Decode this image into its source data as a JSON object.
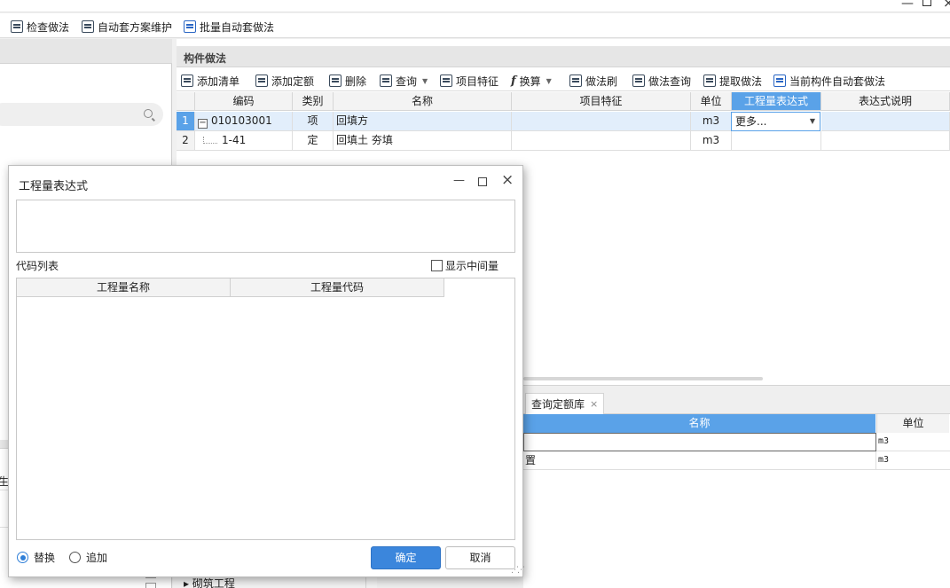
{
  "top_toolbar": {
    "check_method": "检查做法",
    "auto_scheme": "自动套方案维护",
    "batch_auto": "批量自动套做法"
  },
  "main_panel": {
    "title": "构件做法",
    "toolbar": {
      "add_list": "添加清单",
      "add_quota": "添加定额",
      "delete": "删除",
      "query": "查询",
      "feature": "项目特征",
      "convert": "换算",
      "method_brush": "做法刷",
      "method_query": "做法查询",
      "extract": "提取做法",
      "current_auto": "当前构件自动套做法"
    },
    "grid": {
      "columns": [
        "编码",
        "类别",
        "名称",
        "项目特征",
        "单位",
        "工程量表达式",
        "表达式说明"
      ],
      "rows": [
        {
          "num": "1",
          "expander": "−",
          "code": "010103001",
          "type": "项",
          "name": "回填方",
          "feature": "",
          "unit": "m3",
          "expr": "更多...",
          "desc": ""
        },
        {
          "num": "2",
          "code": "1-41",
          "type": "定",
          "name": "回填土 夯填",
          "feature": "",
          "unit": "m3",
          "expr": "",
          "desc": ""
        }
      ]
    }
  },
  "bottom_panel": {
    "tab_label": "查询定额库",
    "tab_close": "×",
    "columns": [
      "名称",
      "单位"
    ],
    "rows": [
      {
        "name": "",
        "unit": "m3"
      },
      {
        "name": "置",
        "unit": "m3"
      }
    ]
  },
  "left_panel": {
    "partial_label": "生"
  },
  "bottom_left": {
    "tree_item": "砌筑工程"
  },
  "dialog": {
    "title": "工程量表达式",
    "code_list_label": "代码列表",
    "show_intermediate": "显示中间量",
    "columns": [
      "工程量名称",
      "工程量代码"
    ],
    "radio_replace": "替换",
    "radio_append": "追加",
    "ok": "确定",
    "cancel": "取消"
  },
  "colors": {
    "accent": "#3b86dc",
    "header_active": "#5aa2e8"
  }
}
